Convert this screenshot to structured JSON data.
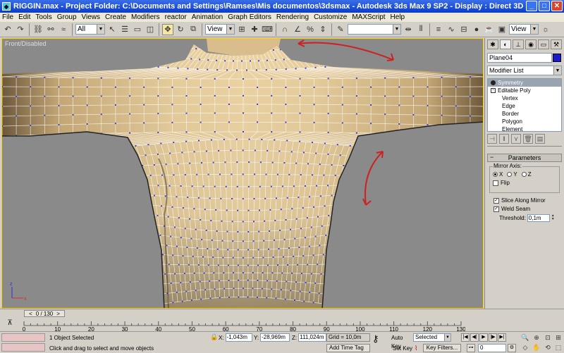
{
  "window": {
    "title": "RIGGIN.max    - Project Folder: C:\\Documents and Settings\\Ramses\\Mis documentos\\3dsmax     - Autodesk 3ds Max 9 SP2     - Display : Direct 3D"
  },
  "menu": [
    "File",
    "Edit",
    "Tools",
    "Group",
    "Views",
    "Create",
    "Modifiers",
    "reactor",
    "Animation",
    "Graph Editors",
    "Rendering",
    "Customize",
    "MAXScript",
    "Help"
  ],
  "toolbar": {
    "selection_filter": "All",
    "ref_coord": "View",
    "named_selection": "",
    "view_dropdown": "View"
  },
  "viewport": {
    "label": "Front/Disabled"
  },
  "command_panel": {
    "object_name": "Plane04",
    "object_color": "#1a1ad0",
    "modifier_list_label": "Modifier List",
    "stack": {
      "top_modifier": "Symmetry",
      "base_object": "Editable Poly",
      "sub_levels": [
        "Vertex",
        "Edge",
        "Border",
        "Polygon",
        "Element"
      ]
    },
    "rollout": {
      "title": "Parameters",
      "mirror_axis_label": "Mirror Axis:",
      "axes": [
        "X",
        "Y",
        "Z"
      ],
      "selected_axis": "X",
      "flip_label": "Flip",
      "flip_checked": false,
      "slice_label": "Slice Along Mirror",
      "slice_checked": true,
      "weld_label": "Weld Seam",
      "weld_checked": true,
      "threshold_label": "Threshold:",
      "threshold_value": "0,1m"
    }
  },
  "timeline": {
    "slider_text": "0 / 130",
    "ticks": [
      "0",
      "10",
      "20",
      "30",
      "40",
      "50",
      "60",
      "70",
      "80",
      "90",
      "100",
      "110",
      "120",
      "130"
    ]
  },
  "status": {
    "selection_text": "1 Object Selected",
    "prompt_text": "Click and drag to select and move objects",
    "x_label": "X:",
    "x_value": "-1,043m",
    "y_label": "Y:",
    "y_value": "-28,969m",
    "z_label": "Z:",
    "z_value": "111,024m",
    "grid": "Grid = 10,0m",
    "add_time_tag": "Add Time Tag",
    "auto_key": "Auto Key",
    "set_key": "Set Key",
    "key_mode_value": "Selected",
    "key_filters": "Key Filters...",
    "current_frame": "0"
  }
}
